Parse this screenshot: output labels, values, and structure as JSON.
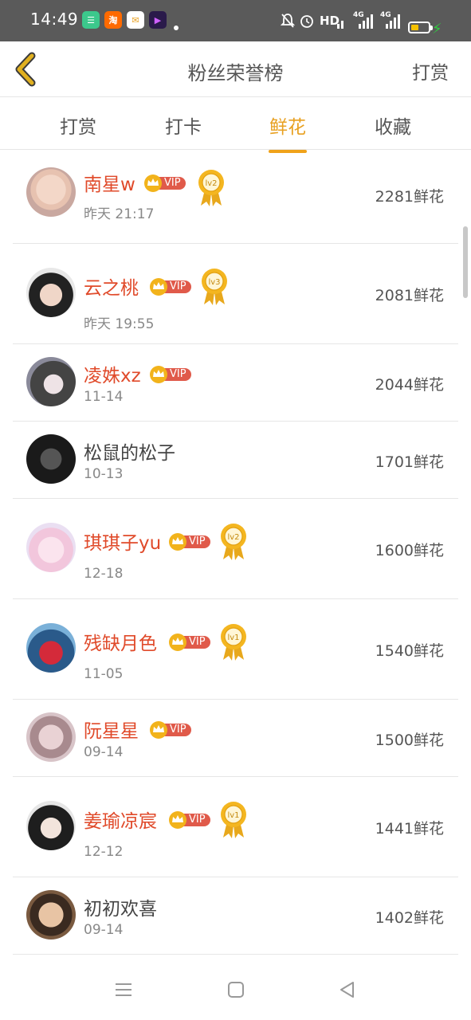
{
  "status_bar": {
    "time": "14:49",
    "hd_label": "HD",
    "net1": "4G",
    "net2": "4G",
    "icons": [
      "app-green-icon",
      "taobao-icon",
      "app-yellow-icon",
      "video-app-icon",
      "mute-bell-icon",
      "alarm-icon",
      "battery-icon",
      "charging-icon"
    ]
  },
  "header": {
    "title": "粉丝荣誉榜",
    "action": "打赏"
  },
  "tabs": [
    {
      "label": "打赏",
      "active": false
    },
    {
      "label": "打卡",
      "active": false
    },
    {
      "label": "鲜花",
      "active": true
    },
    {
      "label": "收藏",
      "active": false
    }
  ],
  "fans": [
    {
      "name": "南星w",
      "date": "昨天 21:17",
      "flowers": "2281鲜花",
      "vip": true,
      "vip_label": "VIP",
      "medal": "lv2"
    },
    {
      "name": "云之桃",
      "date": "昨天 19:55",
      "flowers": "2081鲜花",
      "vip": true,
      "vip_label": "VIP",
      "medal": "lv3"
    },
    {
      "name": "凌姝xz",
      "date": "11-14",
      "flowers": "2044鲜花",
      "vip": true,
      "vip_label": "VIP",
      "medal": null
    },
    {
      "name": "松鼠的松子",
      "date": "10-13",
      "flowers": "1701鲜花",
      "vip": false,
      "vip_label": "",
      "medal": null
    },
    {
      "name": "琪琪子yu",
      "date": "12-18",
      "flowers": "1600鲜花",
      "vip": true,
      "vip_label": "VIP",
      "medal": "lv2"
    },
    {
      "name": "残缺月色",
      "date": "11-05",
      "flowers": "1540鲜花",
      "vip": true,
      "vip_label": "VIP",
      "medal": "lv1"
    },
    {
      "name": "阮星星",
      "date": "09-14",
      "flowers": "1500鲜花",
      "vip": true,
      "vip_label": "VIP",
      "medal": null
    },
    {
      "name": "姜瑜凉宸",
      "date": "12-12",
      "flowers": "1441鲜花",
      "vip": true,
      "vip_label": "VIP",
      "medal": "lv1"
    },
    {
      "name": "初初欢喜",
      "date": "09-14",
      "flowers": "1402鲜花",
      "vip": false,
      "vip_label": "",
      "medal": null
    }
  ],
  "colors": {
    "accent": "#f0a21a",
    "vip_name": "#e04a2a",
    "vip_badge": "#e05a4a",
    "crown": "#f2b31b",
    "back_arrow": "#e0b020"
  },
  "nav_bar": {
    "icons": [
      "menu-icon",
      "home-square-icon",
      "back-triangle-icon"
    ]
  }
}
